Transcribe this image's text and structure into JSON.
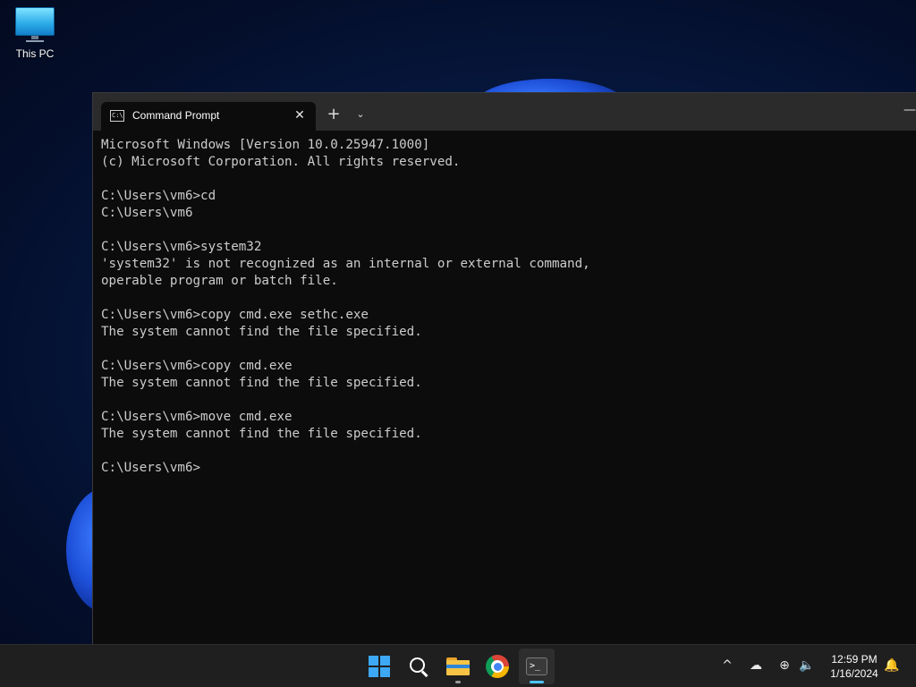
{
  "desktop": {
    "icons": [
      {
        "label": "This PC",
        "icon": "this-pc-icon"
      }
    ]
  },
  "window": {
    "tab": {
      "title": "Command Prompt",
      "icon": "cmd-icon",
      "icon_glyph": "C:\\",
      "close_glyph": "✕"
    },
    "new_tab_glyph": "+",
    "dropdown_glyph": "⌄",
    "minimize_glyph": "—"
  },
  "console": {
    "lines": [
      "Microsoft Windows [Version 10.0.25947.1000]",
      "(c) Microsoft Corporation. All rights reserved.",
      "",
      "C:\\Users\\vm6>cd",
      "C:\\Users\\vm6",
      "",
      "C:\\Users\\vm6>system32",
      "'system32' is not recognized as an internal or external command,",
      "operable program or batch file.",
      "",
      "C:\\Users\\vm6>copy cmd.exe sethc.exe",
      "The system cannot find the file specified.",
      "",
      "C:\\Users\\vm6>copy cmd.exe",
      "The system cannot find the file specified.",
      "",
      "C:\\Users\\vm6>move cmd.exe",
      "The system cannot find the file specified.",
      "",
      "C:\\Users\\vm6>"
    ]
  },
  "taskbar": {
    "apps": [
      "start-icon",
      "search-icon",
      "file-explorer-icon",
      "chrome-icon",
      "terminal-icon"
    ],
    "terminal_glyph": ">_",
    "tray": {
      "chevron_glyph": "^",
      "cloud_glyph": "☁",
      "network_glyph": "⊕",
      "volume_glyph": "🔈",
      "notification_glyph": "🔔"
    },
    "clock": {
      "time": "12:59 PM",
      "date": "1/16/2024"
    }
  },
  "colors": {
    "console_fg": "#cccccc",
    "console_bg": "#0c0c0c",
    "accent": "#3da8f5"
  }
}
